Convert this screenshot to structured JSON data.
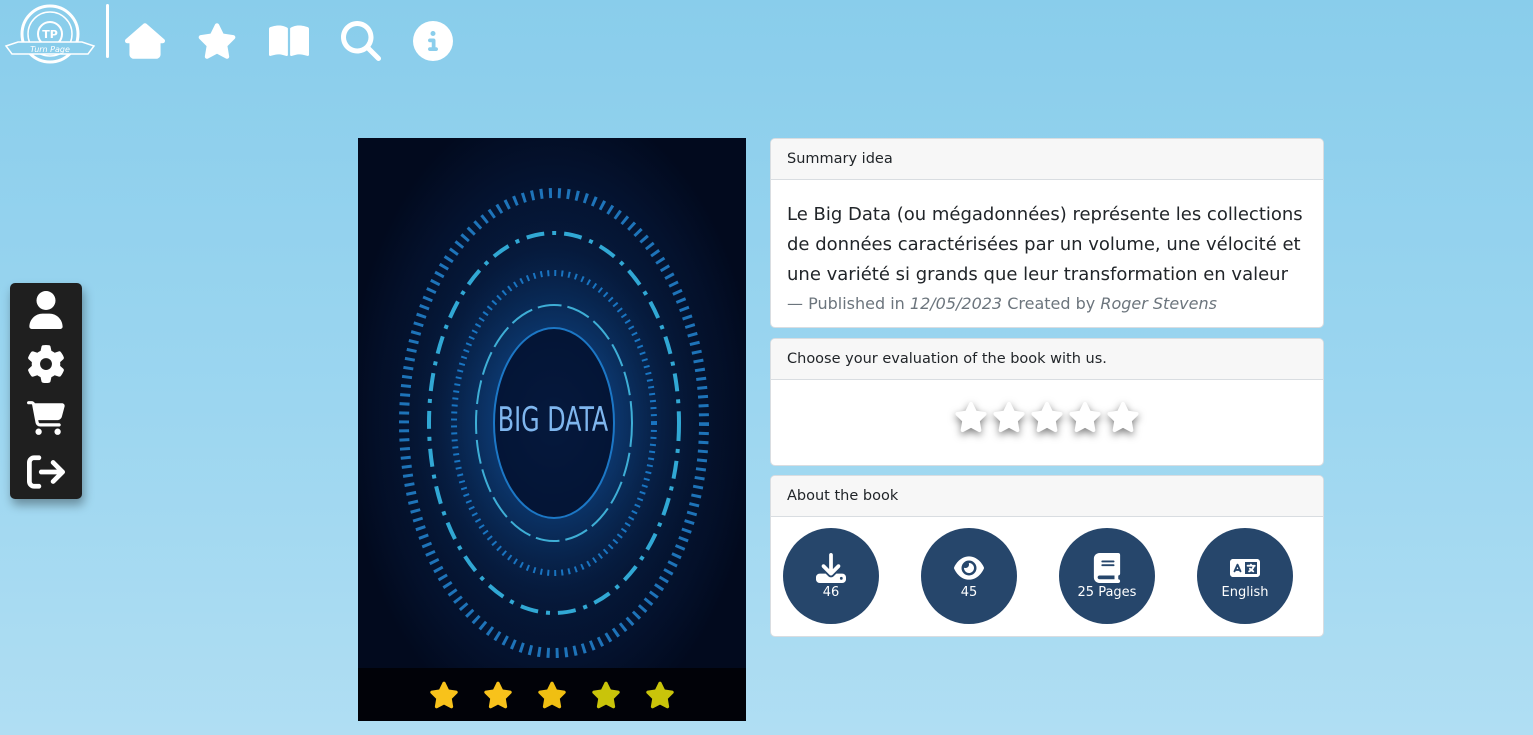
{
  "nav": {
    "logo_text": "TP",
    "logo_banner": "Turn Page",
    "items": [
      {
        "icon": "home-icon"
      },
      {
        "icon": "star-icon"
      },
      {
        "icon": "book-open-icon"
      },
      {
        "icon": "search-icon"
      },
      {
        "icon": "info-icon"
      }
    ]
  },
  "sidebar": {
    "items": [
      {
        "icon": "user-icon"
      },
      {
        "icon": "gear-icon"
      },
      {
        "icon": "cart-icon"
      },
      {
        "icon": "logout-icon"
      }
    ]
  },
  "cover": {
    "title": "BIG DATA",
    "rating": 5,
    "star_colors": [
      "#f8c21b",
      "#f8c21b",
      "#f0bf12",
      "#c9c40a",
      "#c9c40a"
    ]
  },
  "summary": {
    "header": "Summary idea",
    "text": "Le Big Data (ou mégadonnées) représente les collections de données caractérisées par un volume, une vélocité et une variété si grands que leur transformation en valeur",
    "published_prefix": "— Published in",
    "date": "12/05/2023",
    "created_prefix": "Created by",
    "author": "Roger Stevens"
  },
  "evaluation": {
    "header": "Choose your evaluation of the book with us.",
    "rating": 0,
    "max": 5
  },
  "about": {
    "header": "About the book",
    "downloads": "46",
    "views": "45",
    "pages": "25 Pages",
    "language": "English"
  },
  "colors": {
    "accent": "#26466b",
    "background": "#89cdeb"
  }
}
